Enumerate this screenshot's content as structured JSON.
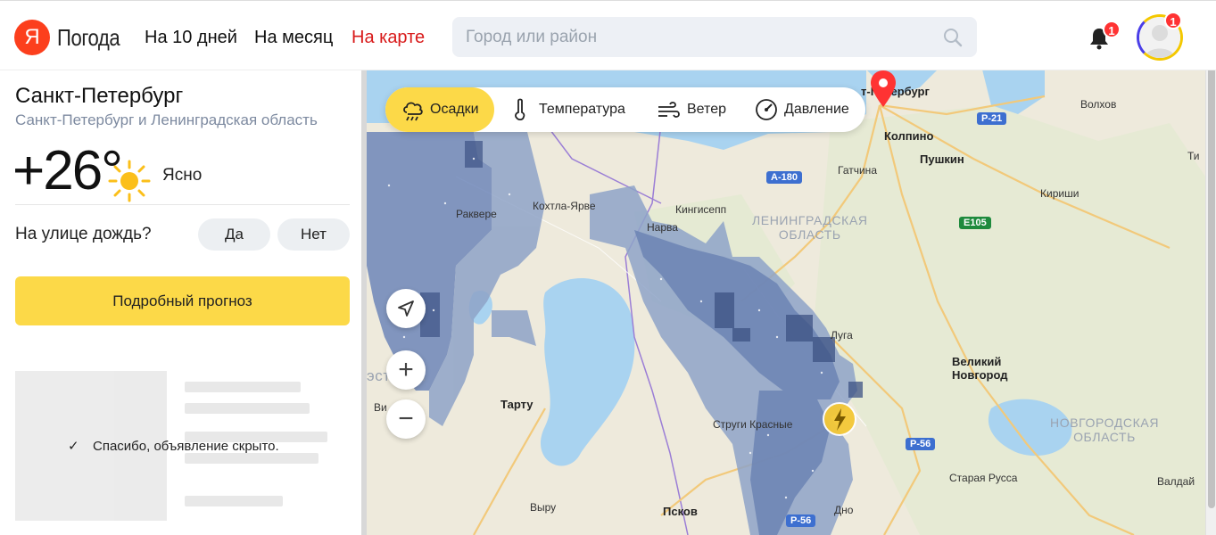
{
  "header": {
    "logo_letter": "Я",
    "logo_text": "Погода",
    "nav": [
      {
        "label": "На 10 дней",
        "active": false
      },
      {
        "label": "На месяц",
        "active": false
      },
      {
        "label": "На карте",
        "active": true
      }
    ],
    "search_placeholder": "Город или район",
    "notifications_count": "1",
    "avatar_badge": "1"
  },
  "weather": {
    "city": "Санкт-Петербург",
    "region": "Санкт-Петербург и Ленинградская область",
    "temperature": "+26°",
    "condition": "Ясно",
    "condition_icon": "sun-icon"
  },
  "rain_poll": {
    "question": "На улице дождь?",
    "yes": "Да",
    "no": "Нет"
  },
  "forecast_button": "Подробный прогноз",
  "ad": {
    "hidden_message": "Спасибо, объявление скрыто."
  },
  "map": {
    "layers": [
      {
        "label": "Осадки",
        "icon": "rain-cloud-icon",
        "active": true
      },
      {
        "label": "Температура",
        "icon": "thermometer-icon",
        "active": false
      },
      {
        "label": "Ветер",
        "icon": "wind-icon",
        "active": false
      },
      {
        "label": "Давление",
        "icon": "pressure-gauge-icon",
        "active": false
      }
    ],
    "controls": {
      "zoom_in": "+",
      "zoom_out": "−"
    },
    "labels": {
      "spb": "т-Петербург",
      "kolpino": "Колпино",
      "pushkin": "Пушкин",
      "gatchina": "Гатчина",
      "volkhov": "Волхов",
      "kirishi": "Кириши",
      "kingisepp": "Кингисепп",
      "kohtla": "Кохтла-Ярве",
      "narva": "Нарва",
      "rakvere": "Раквере",
      "luga": "Луга",
      "velikiy": "Великий\nНовгород",
      "tartu": "Тарту",
      "strugi": "Струги Красные",
      "pskov": "Псков",
      "vyru": "Выру",
      "staraya": "Старая Русса",
      "valday": "Валдай",
      "dno": "Дно",
      "ti": "Ти",
      "vi": "Ви",
      "estonia": "эстония",
      "lenobl": "ЛЕНИНГРАДСКАЯ\nОБЛАСТЬ",
      "novobl": "НОВГОРОДСКАЯ\nОБЛАСТЬ"
    },
    "roads": {
      "p21": "Р-21",
      "a180": "А-180",
      "e105": "Е105",
      "p56a": "Р-56",
      "p56b": "Р-56"
    }
  },
  "colors": {
    "accent_yellow": "#fcd948",
    "brand_red": "#fc3f1d",
    "active_nav": "#d81a1a",
    "precip_light": "#8ea3c8",
    "precip_mid": "#6c84b4",
    "precip_dark": "#3d5284"
  }
}
